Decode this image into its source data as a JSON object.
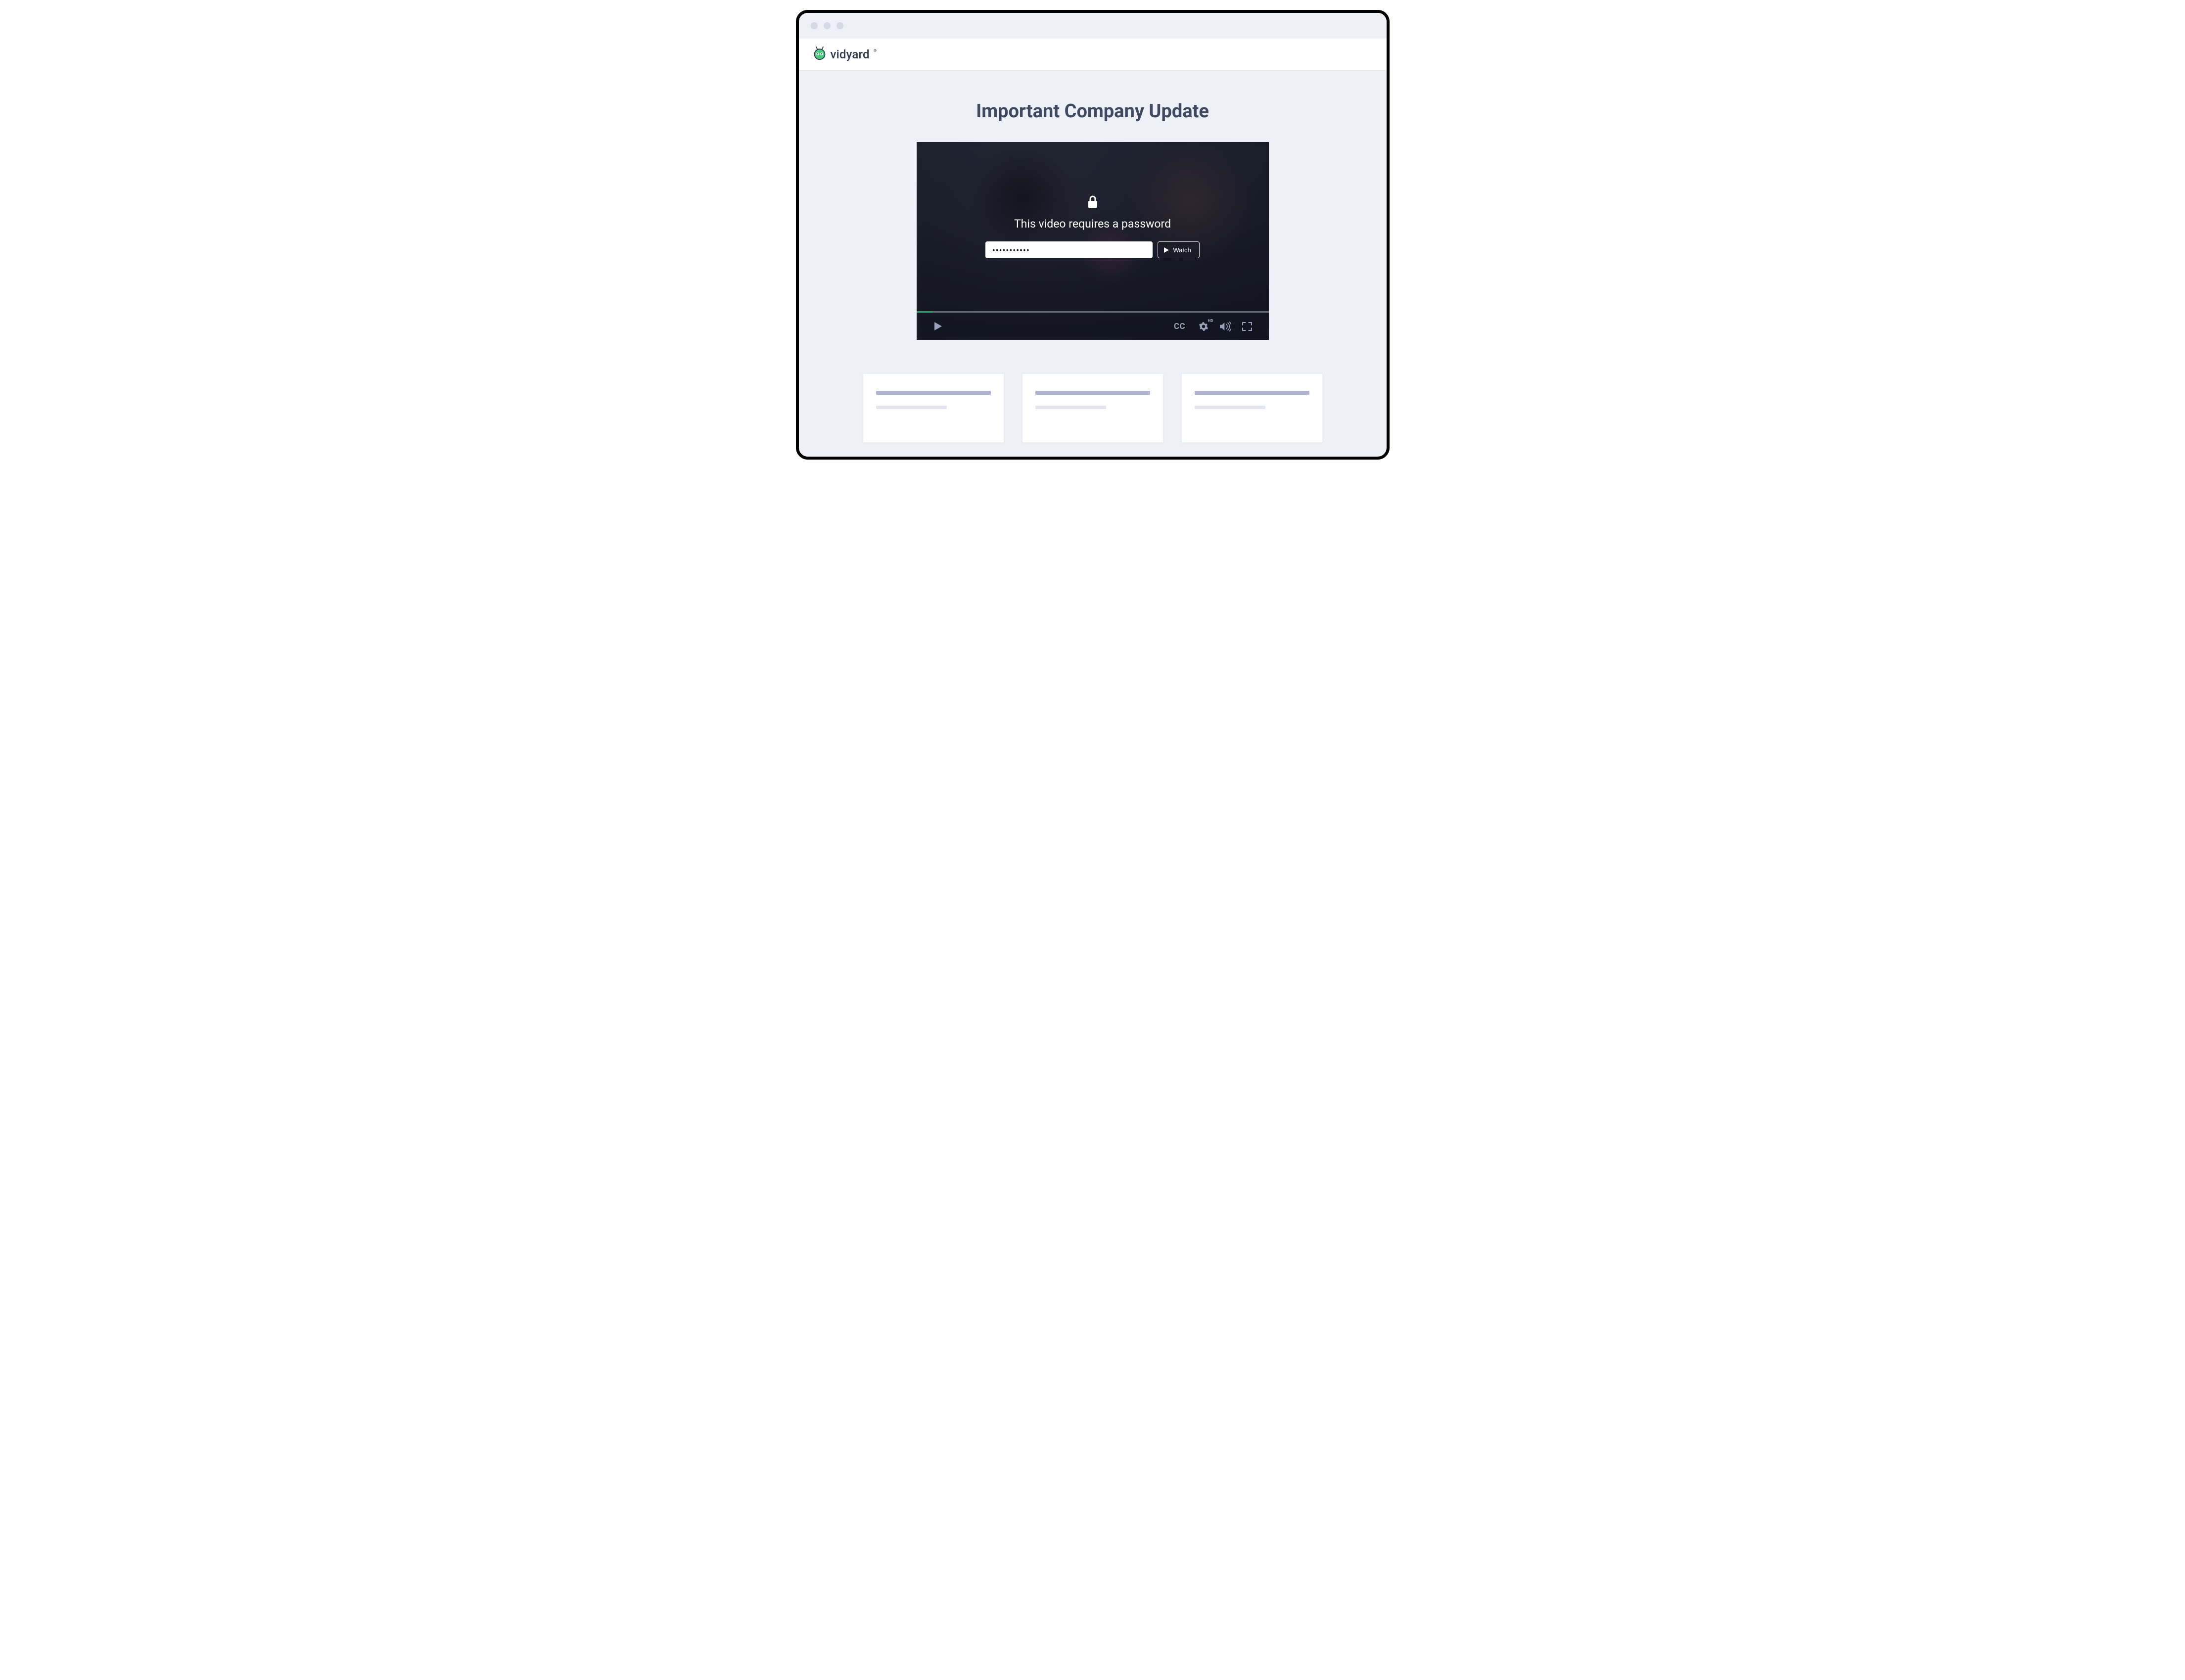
{
  "brand": {
    "name": "vidyard"
  },
  "page": {
    "title": "Important Company Update"
  },
  "video": {
    "lock_message": "This video requires a password",
    "password_value": "•••••••••••",
    "watch_label": "Watch",
    "controls": {
      "cc_label": "CC",
      "hd_label": "HD"
    },
    "progress_percent": 4.5
  }
}
